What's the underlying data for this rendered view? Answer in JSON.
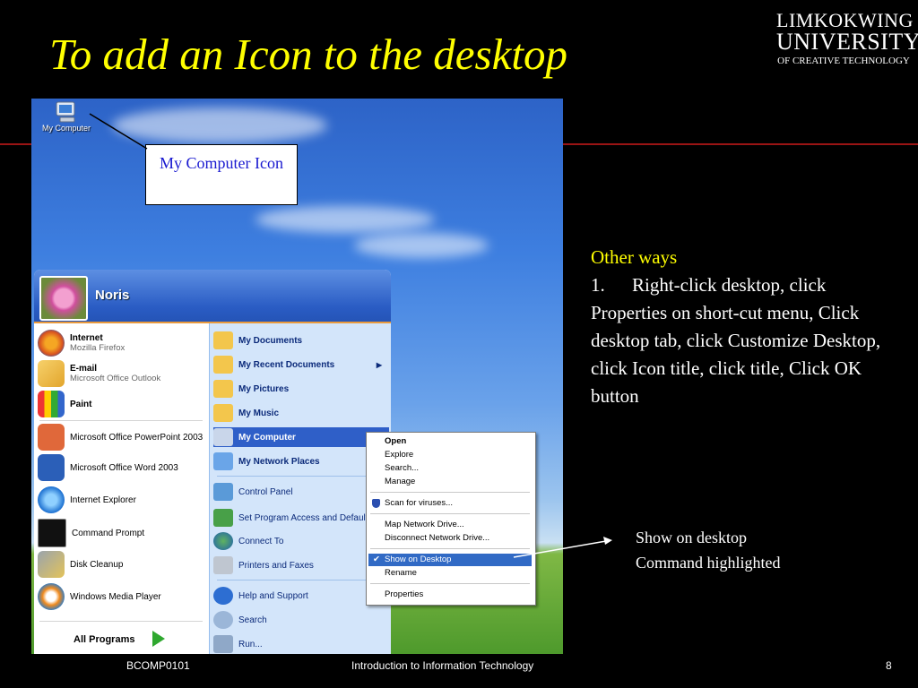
{
  "slide": {
    "title": "To add an Icon to the desktop",
    "logo": {
      "line1": "LIMKOKWING",
      "line2": "UNIVERSITY",
      "line3": "OF CREATIVE TECHNOLOGY"
    },
    "callout": "My Computer Icon",
    "other_ways": {
      "heading": "Other ways",
      "item_number": "1.",
      "item_first_line": "Right-click desktop, click",
      "item_rest": "Properties on short-cut menu, Click desktop tab, click Customize Desktop, click Icon title, click title, Click OK button"
    },
    "note": {
      "line1": "Show on desktop",
      "line2": "Command highlighted"
    },
    "footer": {
      "left": "BCOMP0101",
      "center": "Introduction to Information Technology",
      "page": "8"
    }
  },
  "desktop": {
    "icon_label": "My Computer"
  },
  "start_menu": {
    "user": "Noris",
    "left_items": [
      {
        "title": "Internet",
        "subtitle": "Mozilla Firefox"
      },
      {
        "title": "E-mail",
        "subtitle": "Microsoft Office Outlook"
      },
      {
        "title": "Paint"
      },
      {
        "title": "Microsoft Office PowerPoint 2003"
      },
      {
        "title": "Microsoft Office Word 2003"
      },
      {
        "title": "Internet Explorer"
      },
      {
        "title": "Command Prompt"
      },
      {
        "title": "Disk Cleanup"
      },
      {
        "title": "Windows Media Player"
      }
    ],
    "all_programs": "All Programs",
    "right_items": [
      {
        "label": "My Documents"
      },
      {
        "label": "My Recent Documents"
      },
      {
        "label": "My Pictures"
      },
      {
        "label": "My Music"
      },
      {
        "label": "My Computer"
      },
      {
        "label": "My Network Places"
      },
      {
        "label": "Control Panel"
      },
      {
        "label": "Set Program Access and Defaults"
      },
      {
        "label": "Connect To"
      },
      {
        "label": "Printers and Faxes"
      },
      {
        "label": "Help and Support"
      },
      {
        "label": "Search"
      },
      {
        "label": "Run..."
      }
    ]
  },
  "context_menu": {
    "items": [
      {
        "label": "Open"
      },
      {
        "label": "Explore"
      },
      {
        "label": "Search..."
      },
      {
        "label": "Manage"
      },
      {
        "label": "Scan for viruses..."
      },
      {
        "label": "Map Network Drive..."
      },
      {
        "label": "Disconnect Network Drive..."
      },
      {
        "label": "Show on Desktop"
      },
      {
        "label": "Rename"
      },
      {
        "label": "Properties"
      }
    ]
  },
  "colors": {
    "title": "#ffff00",
    "accent_line": "#9a1414",
    "callout_text": "#1a1ad0",
    "selection": "#316ac5"
  }
}
